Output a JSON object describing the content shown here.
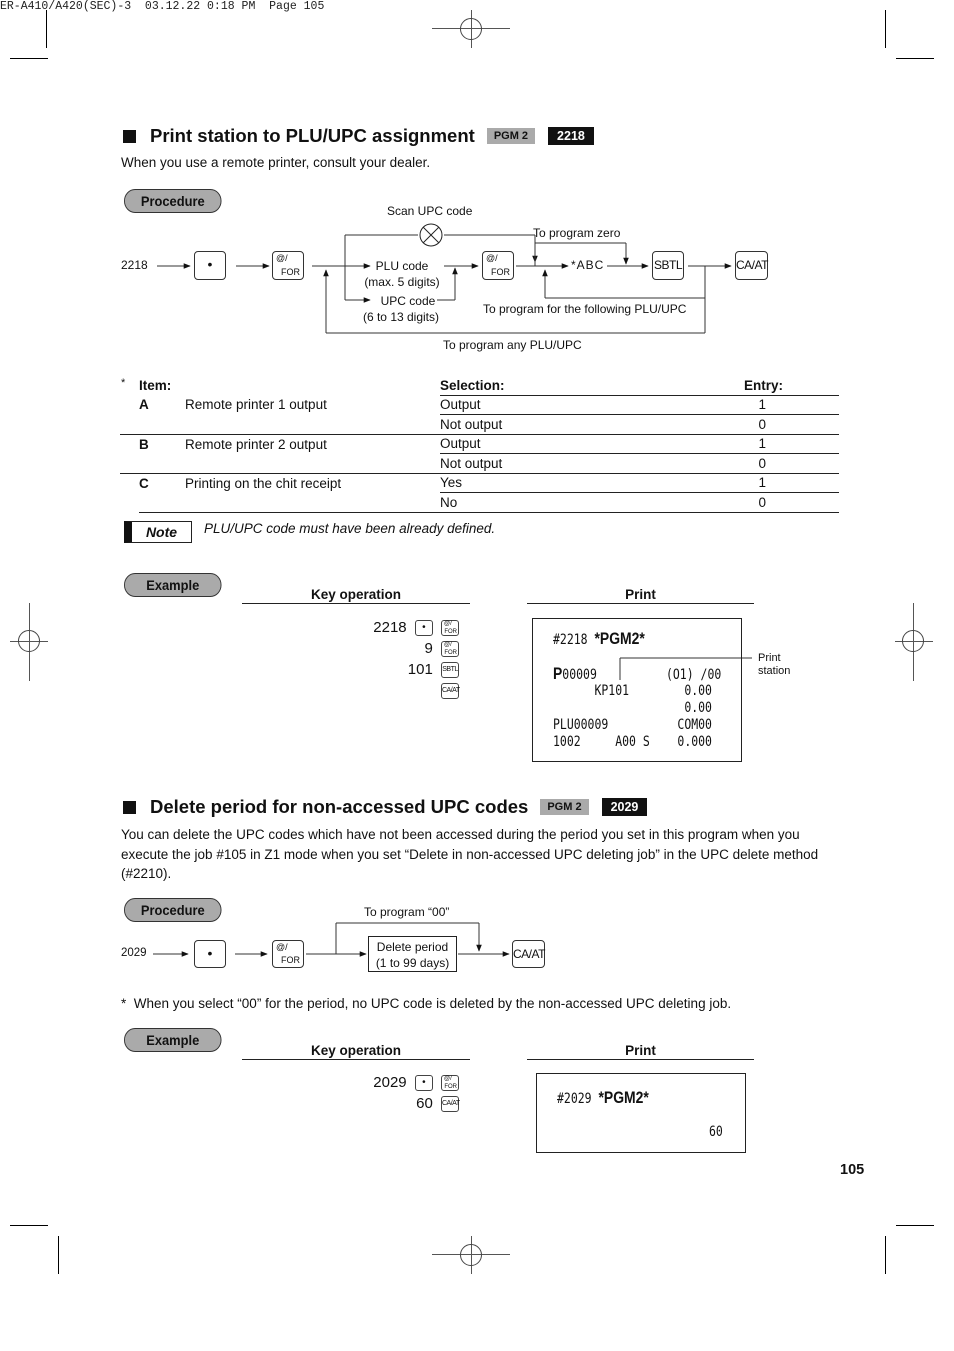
{
  "print_header": "ER-A410/A420(SEC)-3  03.12.22 0:18 PM  Page 105",
  "section1": {
    "title": "Print station to PLU/UPC assignment",
    "mode_tag": "PGM 2",
    "code_tag": "2218",
    "intro": "When you use a remote printer, consult your dealer.",
    "procedure_label": "Procedure",
    "diagram": {
      "start": "2218",
      "keys": {
        "dot": "•",
        "at_for_top": "@/",
        "at_for_bottom": "FOR",
        "sbtl": "SBTL",
        "caat": "CA/AT"
      },
      "scan_label": "Scan UPC code",
      "plu_code": "PLU code",
      "plu_digits": "(max. 5 digits)",
      "upc_code": "UPC code",
      "upc_digits": "(6 to 13 digits)",
      "to_program_zero": "To program zero",
      "abc": "*ABC",
      "to_program_following": "To program for the following PLU/UPC",
      "to_program_any": "To program any PLU/UPC"
    },
    "table": {
      "asterisk": "*",
      "headers": {
        "item": "Item:",
        "selection": "Selection:",
        "entry": "Entry:"
      },
      "rows": [
        {
          "letter": "A",
          "item": "Remote printer 1 output",
          "options": [
            {
              "selection": "Output",
              "entry": "1"
            },
            {
              "selection": "Not output",
              "entry": "0"
            }
          ]
        },
        {
          "letter": "B",
          "item": "Remote printer 2 output",
          "options": [
            {
              "selection": "Output",
              "entry": "1"
            },
            {
              "selection": "Not output",
              "entry": "0"
            }
          ]
        },
        {
          "letter": "C",
          "item": "Printing on the chit receipt",
          "options": [
            {
              "selection": "Yes",
              "entry": "1"
            },
            {
              "selection": "No",
              "entry": "0"
            }
          ]
        }
      ]
    },
    "note_label": "Note",
    "note_text": "PLU/UPC code must have been already defined.",
    "example_label": "Example",
    "key_operation_header": "Key operation",
    "print_header": "Print",
    "key_ops": [
      "2218",
      "9",
      "101",
      ""
    ],
    "receipt": {
      "line1_code": "#2218 ",
      "line1_bold": "*PGM2*",
      "line2_bold": "P",
      "line2_rest": "00009          ",
      "line2_right": "(O1) /00",
      "line3": "      KP101        0.00",
      "line4": "                   0.00",
      "line5": "PLU00009          COM00",
      "line6": "1002     A00 S    0.000"
    },
    "print_station_label_1": "Print",
    "print_station_label_2": "station"
  },
  "section2": {
    "title": "Delete period for non-accessed UPC codes",
    "mode_tag": "PGM 2",
    "code_tag": "2029",
    "intro": "You can delete the UPC codes which have not been accessed during the period you set in this program when you execute the job #105 in Z1 mode when you set “Delete in non-accessed UPC deleting job” in the UPC delete method (#2210).",
    "procedure_label": "Procedure",
    "diagram": {
      "start": "2029",
      "to_program_00": "To program “00”",
      "delete_period": "Delete period",
      "delete_range": "(1 to 99 days)"
    },
    "footnote": "*  When you select “00” for the period, no UPC code is deleted by the non-accessed UPC deleting job.",
    "example_label": "Example",
    "key_operation_header": "Key operation",
    "print_header": "Print",
    "key_ops": [
      "2029",
      "60"
    ],
    "receipt": {
      "line1_code": "#2029 ",
      "line1_bold": "*PGM2*",
      "line2": "60"
    }
  },
  "page_number": "105"
}
